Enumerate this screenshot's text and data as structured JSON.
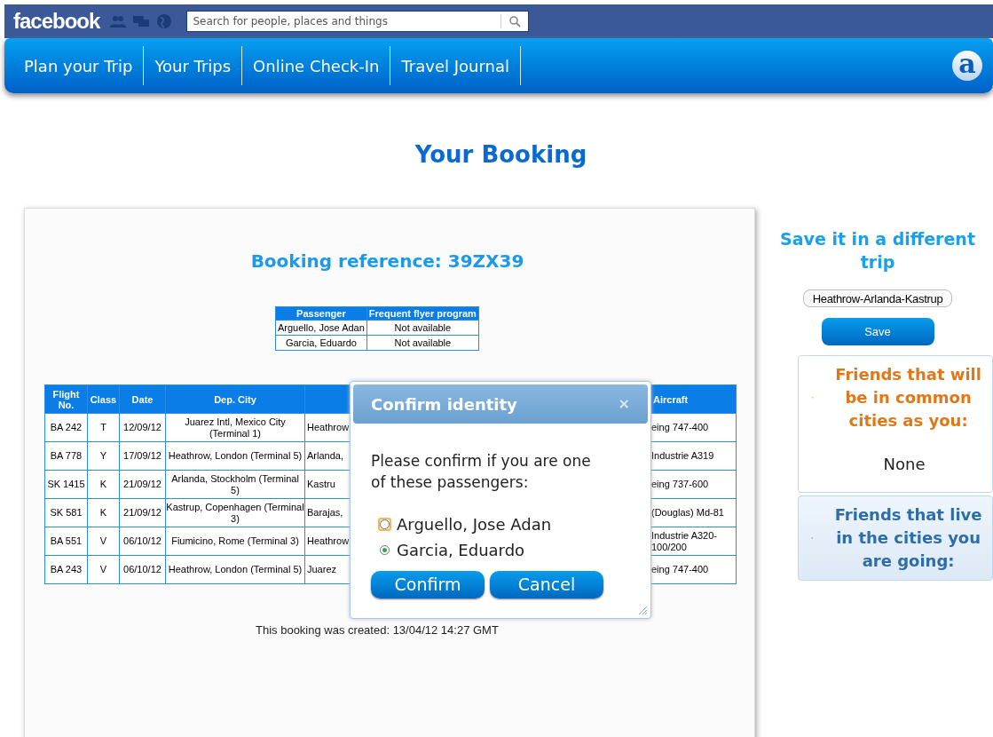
{
  "topbar": {
    "logo": "facebook",
    "search": {
      "placeholder": "Search for people, places and things"
    }
  },
  "nav": {
    "items": [
      {
        "label": "Plan your Trip"
      },
      {
        "label": "Your Trips"
      },
      {
        "label": "Online Check-In"
      },
      {
        "label": "Travel Journal"
      }
    ],
    "brand": "a"
  },
  "page_title": "Your Booking",
  "booking": {
    "reference": "Booking reference: 39ZX39",
    "passengers": {
      "columns": [
        "Passenger",
        "Frequent flyer program"
      ],
      "rows": [
        [
          "Arguello, Jose Adan",
          "Not available"
        ],
        [
          "Garcia, Eduardo",
          "Not available"
        ]
      ]
    },
    "flights": {
      "columns": [
        "Flight No.",
        "Class",
        "Date",
        "Dep. City",
        "",
        "Aircraft"
      ],
      "rows": [
        [
          "BA 242",
          "T",
          "12/09/12",
          "Juarez Intl, Mexico City (Terminal 1)",
          "Heathrow",
          "eing 747-400"
        ],
        [
          "BA 778",
          "Y",
          "17/09/12",
          "Heathrow, London (Terminal 5)",
          "Arlanda,",
          "Industrie A319"
        ],
        [
          "SK 1415",
          "K",
          "21/09/12",
          "Arlanda, Stockholm (Terminal 5)",
          "Kastru",
          "eing 737-600"
        ],
        [
          "SK 581",
          "K",
          "21/09/12",
          "Kastrup, Copenhagen (Terminal 3)",
          "Barajas,",
          "(Douglas) Md-81"
        ],
        [
          "BA 551",
          "V",
          "06/10/12",
          "Fiumicino, Rome (Terminal 3)",
          "Heathrow",
          "Industrie A320-100/200"
        ],
        [
          "BA 243",
          "V",
          "06/10/12",
          "Heathrow, London (Terminal 5)",
          "Juarez",
          "eing 747-400"
        ]
      ]
    },
    "created": "This booking was created: 13/04/12 14:27 GMT"
  },
  "dialog": {
    "title": "Confirm identity",
    "close": "×",
    "message": "Please confirm if you are one of these passengers:",
    "options": [
      {
        "label": "Arguello, Jose Adan",
        "selected": false,
        "focused": true
      },
      {
        "label": "Garcia, Eduardo",
        "selected": true,
        "focused": false
      }
    ],
    "buttons": [
      "Confirm",
      "Cancel"
    ]
  },
  "sidebar": {
    "title": "Save it in a different trip",
    "trip_name": "Heathrow-Arlanda-Kastrup",
    "save": "Save",
    "panels": [
      {
        "title": "Friends that will be in common cities as you:",
        "expanded": true,
        "content": "None"
      },
      {
        "title": "Friends that live in the cities you are going:",
        "expanded": false
      }
    ]
  }
}
